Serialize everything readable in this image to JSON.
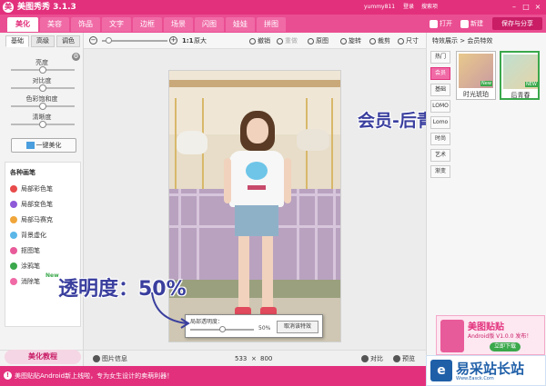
{
  "window": {
    "title": "美图秀秀 3.1.3",
    "user": "yummy811",
    "menu_links": [
      "登录",
      "搜索项"
    ],
    "brand_color": "#e2307c"
  },
  "tabs": [
    "美化",
    "美容",
    "饰品",
    "文字",
    "边框",
    "场景",
    "闪图",
    "娃娃",
    "拼图"
  ],
  "active_tab": "美化",
  "top_buttons": {
    "open": "打开",
    "new": "新建",
    "save_share": "保存与分享"
  },
  "left_panel": {
    "tabs": [
      "基础",
      "高级",
      "调色"
    ],
    "active_tab": "基础",
    "sliders": [
      {
        "label": "亮度",
        "value": 0.5
      },
      {
        "label": "对比度",
        "value": 0.5
      },
      {
        "label": "色彩饱和度",
        "value": 0.5
      },
      {
        "label": "清晰度",
        "value": 0.5
      }
    ],
    "one_click": "一键美化",
    "brushes_title": "各种画笔",
    "brushes": [
      {
        "label": "局部彩色笔",
        "icon": "rainbow-brush-icon",
        "color": "#e84b4b"
      },
      {
        "label": "局部变色笔",
        "icon": "color-change-brush-icon",
        "color": "#8e5ad8"
      },
      {
        "label": "局部马赛克",
        "icon": "mosaic-icon",
        "color": "#f0a63a"
      },
      {
        "label": "背景虚化",
        "icon": "blur-icon",
        "color": "#5ab7e8"
      },
      {
        "label": "抠图笔",
        "icon": "cutout-icon",
        "color": "#e85b9a"
      },
      {
        "label": "涂鸦笔",
        "icon": "doodle-icon",
        "color": "#3aa84b"
      },
      {
        "label": "消除笔",
        "icon": "eraser-icon",
        "color": "#f06aa6"
      }
    ],
    "new_badge": "New",
    "tutorial": "美化教程"
  },
  "toolbar": {
    "zoom_ratio": "1:1",
    "original_size": "原大",
    "zoom_value": 0.05,
    "actions": [
      {
        "label": "撤销",
        "icon": "undo-icon",
        "enabled": true
      },
      {
        "label": "重做",
        "icon": "redo-icon",
        "enabled": false
      },
      {
        "label": "原图",
        "icon": "original-icon",
        "enabled": true
      },
      {
        "label": "旋转",
        "icon": "rotate-icon",
        "enabled": true
      },
      {
        "label": "裁剪",
        "icon": "crop-icon",
        "enabled": true
      },
      {
        "label": "尺寸",
        "icon": "resize-icon",
        "enabled": true
      }
    ]
  },
  "opacity_dialog": {
    "label": "局部透明度：",
    "percent": "50%",
    "value": 0.5,
    "cancel": "取消该特效"
  },
  "annotations": {
    "opacity": "透明度：50%",
    "member": "会员-后青春"
  },
  "status_bar": {
    "image_info": "图片信息",
    "width": "533",
    "times": "×",
    "height": "800",
    "compare": "对比",
    "preview": "预览"
  },
  "right_panel": {
    "header": "特效展示 > 会员特效",
    "categories": [
      "热门",
      "会员",
      "基础",
      "LOMO",
      "Lomo",
      "时尚",
      "艺术",
      "渐变"
    ],
    "active_category": "会员",
    "thumbs": [
      {
        "label": "时光琥珀",
        "new": "New",
        "selected": false
      },
      {
        "label": "后青春",
        "new": "NEW",
        "selected": true
      }
    ]
  },
  "ad": {
    "title": "美图贴贴",
    "subtitle": "Android版 V1.0.0 发布！",
    "button": "立即下载"
  },
  "watermark": {
    "text": "易采站长站",
    "sub": "Www.Easck.Com"
  },
  "footer": {
    "message": "美图贴贴Android新上线啦，专为女生设计的卖萌利器！"
  }
}
